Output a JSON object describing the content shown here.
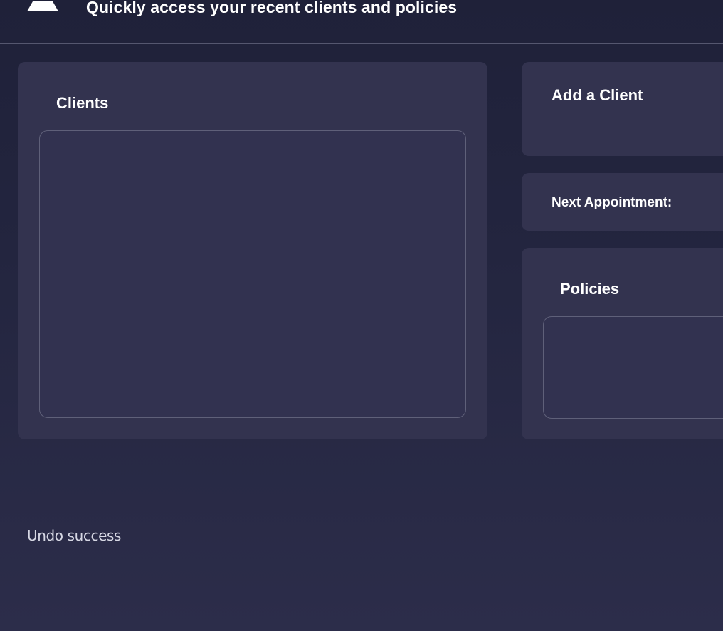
{
  "header": {
    "subtitle": "Quickly access your recent clients and policies"
  },
  "clients_panel": {
    "title": "Clients",
    "items": []
  },
  "add_client_panel": {
    "title": "Add a Client"
  },
  "appointment_panel": {
    "label": "Next Appointment:"
  },
  "policies_panel": {
    "title": "Policies",
    "items": []
  },
  "status": {
    "message": "Undo success"
  },
  "icons": {
    "logo": "logo-icon"
  },
  "colors": {
    "background": "#1f2139",
    "card": "#33334f",
    "divider": "#55576f",
    "text": "#ffffff"
  }
}
